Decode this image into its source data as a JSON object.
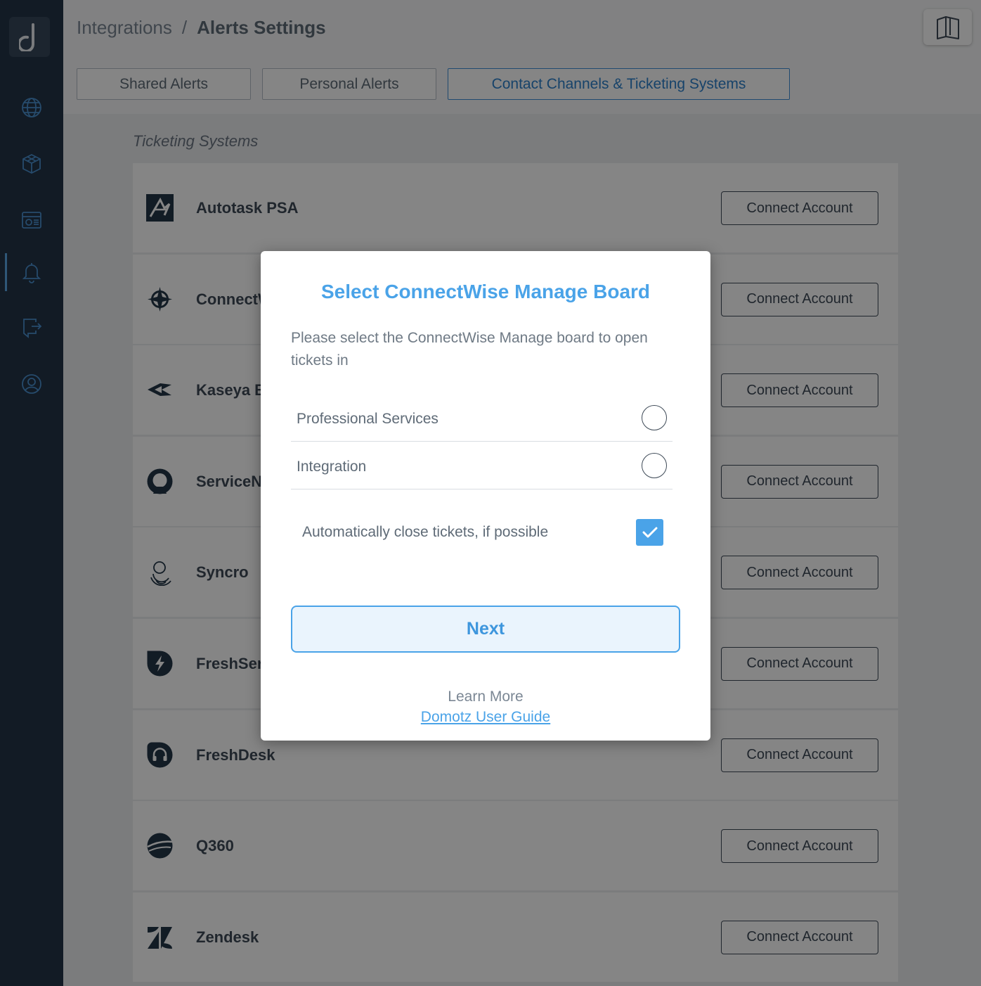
{
  "breadcrumb": {
    "parent": "Integrations",
    "separator": "/",
    "current": "Alerts Settings"
  },
  "sidebar": {
    "items": [
      {
        "icon": "globe-icon"
      },
      {
        "icon": "cube-icon"
      },
      {
        "icon": "dashboard-icon"
      },
      {
        "icon": "bell-icon",
        "active": true
      },
      {
        "icon": "export-icon"
      },
      {
        "icon": "user-icon"
      }
    ]
  },
  "tabs": [
    {
      "label": "Shared Alerts"
    },
    {
      "label": "Personal Alerts"
    },
    {
      "label": "Contact Channels & Ticketing Systems",
      "active": true
    }
  ],
  "section": {
    "title": "Ticketing Systems"
  },
  "systems": [
    {
      "name": "Autotask PSA",
      "icon": "autotask-icon",
      "button": "Connect Account"
    },
    {
      "name": "ConnectWise",
      "icon": "connectwise-icon",
      "button": "Connect Account"
    },
    {
      "name": "Kaseya BMS",
      "icon": "kaseya-icon",
      "button": "Connect Account"
    },
    {
      "name": "ServiceNow",
      "icon": "servicenow-icon",
      "button": "Connect Account"
    },
    {
      "name": "Syncro",
      "icon": "syncro-icon",
      "button": "Connect Account"
    },
    {
      "name": "FreshService",
      "icon": "freshservice-icon",
      "button": "Connect Account"
    },
    {
      "name": "FreshDesk",
      "icon": "freshdesk-icon",
      "button": "Connect Account"
    },
    {
      "name": "Q360",
      "icon": "q360-icon",
      "button": "Connect Account"
    },
    {
      "name": "Zendesk",
      "icon": "zendesk-icon",
      "button": "Connect Account"
    }
  ],
  "modal": {
    "title": "Select ConnectWise Manage Board",
    "description": "Please select the ConnectWise Manage board to open tickets in",
    "options": [
      {
        "label": "Professional Services",
        "selected": false
      },
      {
        "label": "Integration",
        "selected": false
      }
    ],
    "auto_close": {
      "label": "Automatically close tickets, if possible",
      "checked": true
    },
    "next_label": "Next",
    "learn_more": "Learn More",
    "guide_link": "Domotz User Guide"
  },
  "colors": {
    "sidebar": "#243447",
    "accent": "#4aa3e8",
    "overlay": "rgba(0,0,0,0.48)"
  }
}
